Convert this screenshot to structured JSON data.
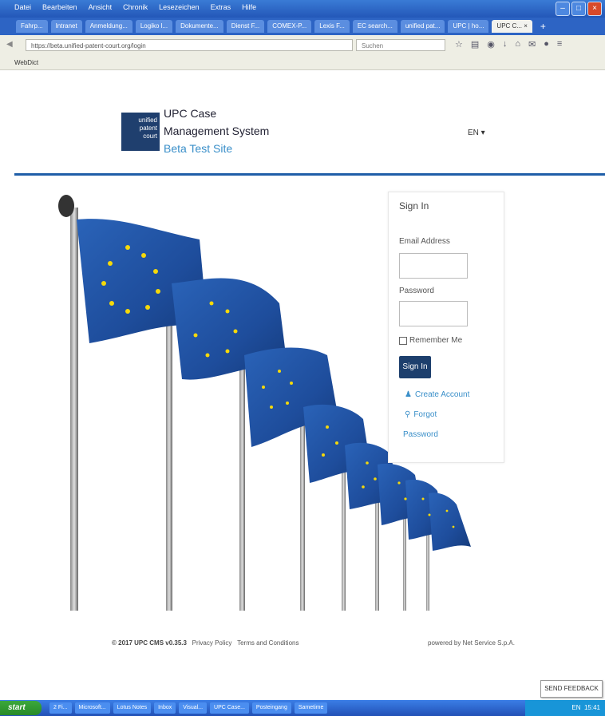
{
  "browser": {
    "menu": [
      "Datei",
      "Bearbeiten",
      "Ansicht",
      "Chronik",
      "Lesezeichen",
      "Extras",
      "Hilfe"
    ],
    "tabs": [
      "Fahrp...",
      "Intranet",
      "Anmeldung...",
      "Logiko l...",
      "Dokumente...",
      "Dienst F...",
      "COMEX-P...",
      "Lexis F...",
      "EC search...",
      "unified pat...",
      "UPC | ho...",
      "UPC C... ×"
    ],
    "url": "https://beta.unified-patent-court.org/login",
    "search_placeholder": "Suchen",
    "bookmark": "WebDict"
  },
  "header": {
    "logo_text": [
      "unified",
      "patent",
      "court"
    ],
    "title_line1": "UPC Case",
    "title_line2": "Management System",
    "title_line3": "Beta Test Site",
    "language": "EN"
  },
  "signin": {
    "title": "Sign In",
    "email_label": "Email Address",
    "password_label": "Password",
    "remember_label": "Remember Me",
    "button": "Sign In",
    "create_account": "Create Account",
    "forgot": "Forgot",
    "password_link": "Password"
  },
  "footer": {
    "copyright": "© 2017 UPC CMS v0.35.3",
    "privacy": "Privacy Policy",
    "terms": "Terms and Conditions",
    "powered": "powered by Net Service S.p.A."
  },
  "popup": {
    "text": "SEND FEEDBACK"
  },
  "taskbar": {
    "start": "start",
    "items": [
      "2 Fi...",
      "Microsoft...",
      "Lotus Notes",
      "Inbox",
      "Visual...",
      "UPC Case...",
      "Posteingang",
      "Sametime",
      "EN"
    ],
    "tray_time": "15:41"
  },
  "colors": {
    "brand": "#1d3f6d",
    "accent": "#3a8fc9",
    "rule": "#1f5ea8",
    "flag_blue": "#1f4fa0",
    "star": "#f5d90a"
  }
}
